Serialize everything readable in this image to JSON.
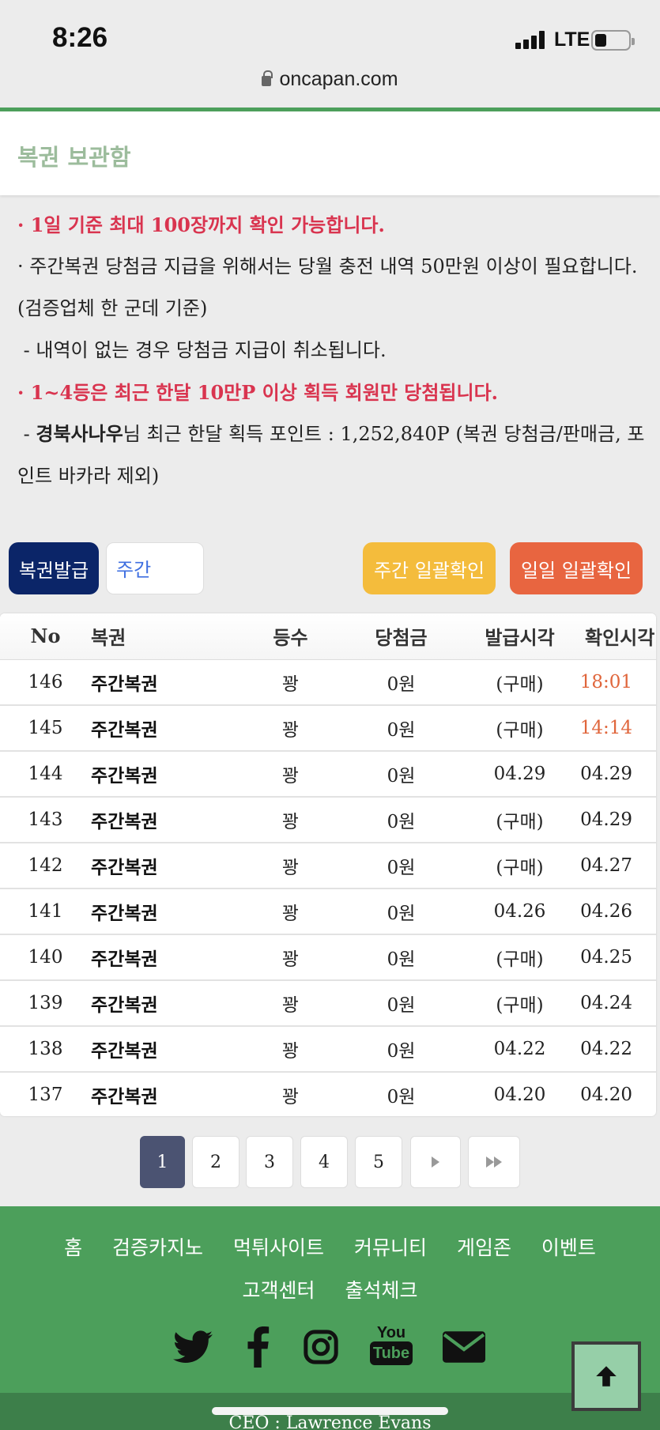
{
  "status_bar": {
    "time": "8:26",
    "network": "LTE"
  },
  "browser": {
    "url": "oncapan.com"
  },
  "header": {
    "title": "복권 보관함"
  },
  "notes": {
    "line1": "· 1일 기준 최대 100장까지 확인 가능합니다.",
    "line2": "· 주간복권 당첨금 지급을 위해서는 당월 충전 내역 50만원 이상이 필요합니다. (검증업체 한 군데 기준)",
    "line3": "- 내역이 없는 경우 당첨금 지급이 취소됩니다.",
    "line4": "· 1~4등은 최근 한달 10만P 이상 획득 회원만 당첨됩니다.",
    "line5_prefix": "- ",
    "line5_name": "경북사나우",
    "line5_rest": "님 최근 한달 획득 포인트 : 1,252,840P (복권 당첨금/판매금, 포인트 바카라 제외)"
  },
  "controls": {
    "issue_button": "복권발급",
    "type_select": "주간",
    "weekly_check_button": "주간 일괄확인",
    "daily_check_button": "일일 일괄확인"
  },
  "table": {
    "headers": [
      "No",
      "복권",
      "등수",
      "당첨금",
      "발급시각",
      "확인시각"
    ],
    "rows": [
      {
        "no": "146",
        "kind": "주간복권",
        "rank": "꽝",
        "prize": "0원",
        "issued": "(구매)",
        "checked": "18:01"
      },
      {
        "no": "145",
        "kind": "주간복권",
        "rank": "꽝",
        "prize": "0원",
        "issued": "(구매)",
        "checked": "14:14"
      },
      {
        "no": "144",
        "kind": "주간복권",
        "rank": "꽝",
        "prize": "0원",
        "issued": "04.29",
        "checked": "04.29"
      },
      {
        "no": "143",
        "kind": "주간복권",
        "rank": "꽝",
        "prize": "0원",
        "issued": "(구매)",
        "checked": "04.29"
      },
      {
        "no": "142",
        "kind": "주간복권",
        "rank": "꽝",
        "prize": "0원",
        "issued": "(구매)",
        "checked": "04.27"
      },
      {
        "no": "141",
        "kind": "주간복권",
        "rank": "꽝",
        "prize": "0원",
        "issued": "04.26",
        "checked": "04.26"
      },
      {
        "no": "140",
        "kind": "주간복권",
        "rank": "꽝",
        "prize": "0원",
        "issued": "(구매)",
        "checked": "04.25"
      },
      {
        "no": "139",
        "kind": "주간복권",
        "rank": "꽝",
        "prize": "0원",
        "issued": "(구매)",
        "checked": "04.24"
      },
      {
        "no": "138",
        "kind": "주간복권",
        "rank": "꽝",
        "prize": "0원",
        "issued": "04.22",
        "checked": "04.22"
      },
      {
        "no": "137",
        "kind": "주간복권",
        "rank": "꽝",
        "prize": "0원",
        "issued": "04.20",
        "checked": "04.20"
      }
    ]
  },
  "pagination": {
    "pages": [
      "1",
      "2",
      "3",
      "4",
      "5"
    ],
    "current": "1"
  },
  "footer": {
    "links": [
      "홈",
      "검증카지노",
      "먹튀사이트",
      "커뮤니티",
      "게임존",
      "이벤트",
      "고객센터",
      "출석체크"
    ],
    "social_icons": [
      "twitter-icon",
      "facebook-icon",
      "instagram-icon",
      "youtube-icon",
      "email-icon"
    ],
    "youtube_label_top": "You",
    "youtube_label_bottom": "Tube",
    "ceo": "CEO : Lawrence Evans"
  },
  "colors": {
    "brand_green": "#4c9f5b",
    "accent_red": "#d9344f",
    "navy": "#0b2568",
    "yellow": "#f4bc3c",
    "orange": "#e86540"
  }
}
